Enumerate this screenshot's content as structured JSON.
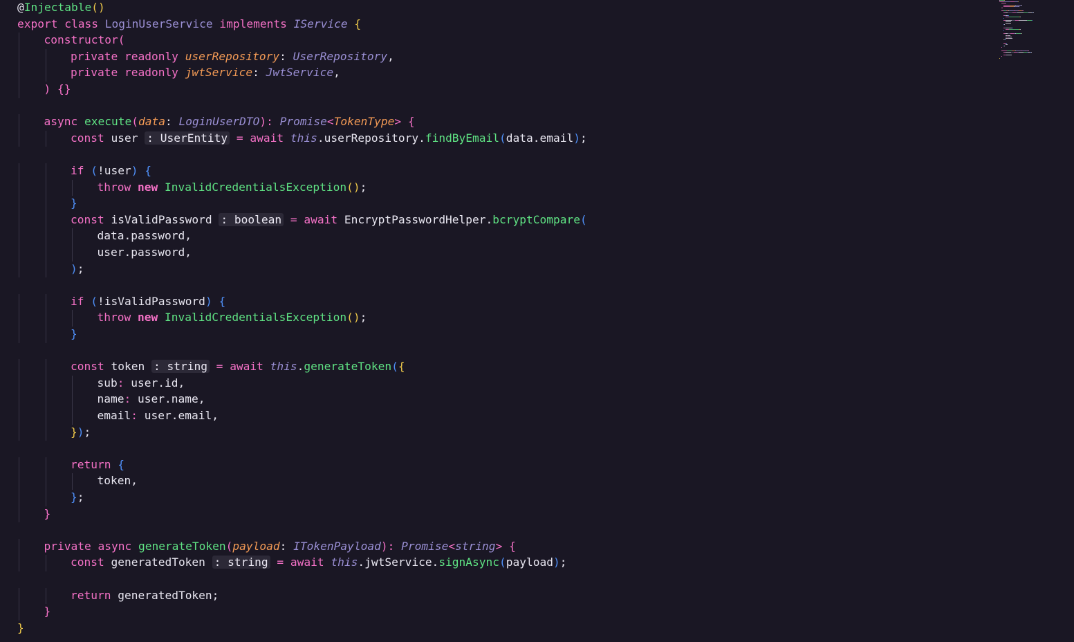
{
  "colors": {
    "background": "#1a1724",
    "plain": "#e8e6f0",
    "keyword": "#f471c6",
    "function": "#5fe283",
    "type": "#9a8fd4",
    "param": "#f39a55",
    "punct_blue": "#4f8ff7",
    "punct_yellow": "#ecc74a",
    "guide": "#3a3648"
  },
  "code": {
    "lines": [
      {
        "indent": 0,
        "tokens": [
          [
            "@",
            "plain"
          ],
          [
            "Injectable",
            "function"
          ],
          [
            "()",
            "punct_yellow"
          ]
        ]
      },
      {
        "indent": 0,
        "tokens": [
          [
            "export class ",
            "keyword"
          ],
          [
            "LoginUserService ",
            "type"
          ],
          [
            "implements ",
            "keyword"
          ],
          [
            "IService ",
            "type italic"
          ],
          [
            "{",
            "punct_yellow"
          ]
        ]
      },
      {
        "indent": 1,
        "tokens": [
          [
            "constructor",
            "keyword"
          ],
          [
            "(",
            "keyword"
          ]
        ]
      },
      {
        "indent": 2,
        "tokens": [
          [
            "private readonly ",
            "keyword"
          ],
          [
            "userRepository",
            "param italic"
          ],
          [
            ": ",
            "plain"
          ],
          [
            "UserRepository",
            "type italic"
          ],
          [
            ",",
            "plain"
          ]
        ]
      },
      {
        "indent": 2,
        "tokens": [
          [
            "private readonly ",
            "keyword"
          ],
          [
            "jwtService",
            "param italic"
          ],
          [
            ": ",
            "plain"
          ],
          [
            "JwtService",
            "type italic"
          ],
          [
            ",",
            "plain"
          ]
        ]
      },
      {
        "indent": 1,
        "tokens": [
          [
            ") ",
            "keyword"
          ],
          [
            "{}",
            "keyword"
          ]
        ]
      },
      {
        "indent": 0,
        "tokens": []
      },
      {
        "indent": 1,
        "tokens": [
          [
            "async ",
            "keyword"
          ],
          [
            "execute",
            "function"
          ],
          [
            "(",
            "keyword"
          ],
          [
            "data",
            "param italic"
          ],
          [
            ": ",
            "plain"
          ],
          [
            "LoginUserDTO",
            "type italic"
          ],
          [
            "): ",
            "keyword"
          ],
          [
            "Promise",
            "type italic"
          ],
          [
            "<",
            "keyword"
          ],
          [
            "TokenType",
            "param italic"
          ],
          [
            "> ",
            "keyword"
          ],
          [
            "{",
            "keyword"
          ]
        ]
      },
      {
        "indent": 2,
        "tokens": [
          [
            "const ",
            "keyword"
          ],
          [
            "user ",
            "plain"
          ],
          [
            ": UserEntity",
            "hint"
          ],
          [
            " = ",
            "keyword"
          ],
          [
            "await ",
            "keyword"
          ],
          [
            "this",
            "type italic"
          ],
          [
            ".userRepository.",
            "plain"
          ],
          [
            "findByEmail",
            "function"
          ],
          [
            "(",
            "punct_blue"
          ],
          [
            "data.email",
            "plain"
          ],
          [
            ")",
            "punct_blue"
          ],
          [
            ";",
            "plain"
          ]
        ]
      },
      {
        "indent": 0,
        "tokens": []
      },
      {
        "indent": 2,
        "tokens": [
          [
            "if ",
            "keyword"
          ],
          [
            "(",
            "punct_blue"
          ],
          [
            "!user",
            "plain"
          ],
          [
            ") ",
            "punct_blue"
          ],
          [
            "{",
            "punct_blue"
          ]
        ]
      },
      {
        "indent": 3,
        "tokens": [
          [
            "throw ",
            "keyword"
          ],
          [
            "new ",
            "keyword bold"
          ],
          [
            "InvalidCredentialsException",
            "function"
          ],
          [
            "()",
            "punct_yellow"
          ],
          [
            ";",
            "plain"
          ]
        ]
      },
      {
        "indent": 2,
        "tokens": [
          [
            "}",
            "punct_blue"
          ]
        ]
      },
      {
        "indent": 2,
        "tokens": [
          [
            "const ",
            "keyword"
          ],
          [
            "isValidPassword ",
            "plain"
          ],
          [
            ": boolean",
            "hint"
          ],
          [
            " = ",
            "keyword"
          ],
          [
            "await ",
            "keyword"
          ],
          [
            "EncryptPasswordHelper.",
            "plain"
          ],
          [
            "bcryptCompare",
            "function"
          ],
          [
            "(",
            "punct_blue"
          ]
        ]
      },
      {
        "indent": 3,
        "tokens": [
          [
            "data.password,",
            "plain"
          ]
        ]
      },
      {
        "indent": 3,
        "tokens": [
          [
            "user.password,",
            "plain"
          ]
        ]
      },
      {
        "indent": 2,
        "tokens": [
          [
            ")",
            "punct_blue"
          ],
          [
            ";",
            "plain"
          ]
        ]
      },
      {
        "indent": 0,
        "tokens": []
      },
      {
        "indent": 2,
        "tokens": [
          [
            "if ",
            "keyword"
          ],
          [
            "(",
            "punct_blue"
          ],
          [
            "!isValidPassword",
            "plain"
          ],
          [
            ") ",
            "punct_blue"
          ],
          [
            "{",
            "punct_blue"
          ]
        ]
      },
      {
        "indent": 3,
        "tokens": [
          [
            "throw ",
            "keyword"
          ],
          [
            "new ",
            "keyword bold"
          ],
          [
            "InvalidCredentialsException",
            "function"
          ],
          [
            "()",
            "punct_yellow"
          ],
          [
            ";",
            "plain"
          ]
        ]
      },
      {
        "indent": 2,
        "tokens": [
          [
            "}",
            "punct_blue"
          ]
        ]
      },
      {
        "indent": 0,
        "tokens": []
      },
      {
        "indent": 2,
        "tokens": [
          [
            "const ",
            "keyword"
          ],
          [
            "token ",
            "plain"
          ],
          [
            ": string",
            "hint"
          ],
          [
            " = ",
            "keyword"
          ],
          [
            "await ",
            "keyword"
          ],
          [
            "this",
            "type italic"
          ],
          [
            ".",
            "plain"
          ],
          [
            "generateToken",
            "function"
          ],
          [
            "(",
            "punct_blue"
          ],
          [
            "{",
            "punct_yellow"
          ]
        ]
      },
      {
        "indent": 3,
        "tokens": [
          [
            "sub",
            "plain"
          ],
          [
            ": ",
            "keyword"
          ],
          [
            "user.id,",
            "plain"
          ]
        ]
      },
      {
        "indent": 3,
        "tokens": [
          [
            "name",
            "plain"
          ],
          [
            ": ",
            "keyword"
          ],
          [
            "user.name,",
            "plain"
          ]
        ]
      },
      {
        "indent": 3,
        "tokens": [
          [
            "email",
            "plain"
          ],
          [
            ": ",
            "keyword"
          ],
          [
            "user.email,",
            "plain"
          ]
        ]
      },
      {
        "indent": 2,
        "tokens": [
          [
            "}",
            "punct_yellow"
          ],
          [
            ")",
            "punct_blue"
          ],
          [
            ";",
            "plain"
          ]
        ]
      },
      {
        "indent": 0,
        "tokens": []
      },
      {
        "indent": 2,
        "tokens": [
          [
            "return ",
            "keyword"
          ],
          [
            "{",
            "punct_blue"
          ]
        ]
      },
      {
        "indent": 3,
        "tokens": [
          [
            "token,",
            "plain"
          ]
        ]
      },
      {
        "indent": 2,
        "tokens": [
          [
            "}",
            "punct_blue"
          ],
          [
            ";",
            "plain"
          ]
        ]
      },
      {
        "indent": 1,
        "tokens": [
          [
            "}",
            "keyword"
          ]
        ]
      },
      {
        "indent": 0,
        "tokens": []
      },
      {
        "indent": 1,
        "tokens": [
          [
            "private async ",
            "keyword"
          ],
          [
            "generateToken",
            "function"
          ],
          [
            "(",
            "keyword"
          ],
          [
            "payload",
            "param italic"
          ],
          [
            ": ",
            "plain"
          ],
          [
            "ITokenPayload",
            "type italic"
          ],
          [
            "): ",
            "keyword"
          ],
          [
            "Promise",
            "type italic"
          ],
          [
            "<",
            "keyword"
          ],
          [
            "string",
            "type italic"
          ],
          [
            "> ",
            "keyword"
          ],
          [
            "{",
            "keyword"
          ]
        ]
      },
      {
        "indent": 2,
        "tokens": [
          [
            "const ",
            "keyword"
          ],
          [
            "generatedToken ",
            "plain"
          ],
          [
            ": string",
            "hint"
          ],
          [
            " = ",
            "keyword"
          ],
          [
            "await ",
            "keyword"
          ],
          [
            "this",
            "type italic"
          ],
          [
            ".jwtService.",
            "plain"
          ],
          [
            "signAsync",
            "function"
          ],
          [
            "(",
            "punct_blue"
          ],
          [
            "payload",
            "plain"
          ],
          [
            ")",
            "punct_blue"
          ],
          [
            ";",
            "plain"
          ]
        ]
      },
      {
        "indent": 0,
        "tokens": []
      },
      {
        "indent": 2,
        "tokens": [
          [
            "return ",
            "keyword"
          ],
          [
            "generatedToken;",
            "plain"
          ]
        ]
      },
      {
        "indent": 1,
        "tokens": [
          [
            "}",
            "keyword"
          ]
        ]
      },
      {
        "indent": 0,
        "tokens": [
          [
            "}",
            "punct_yellow"
          ]
        ]
      }
    ]
  }
}
